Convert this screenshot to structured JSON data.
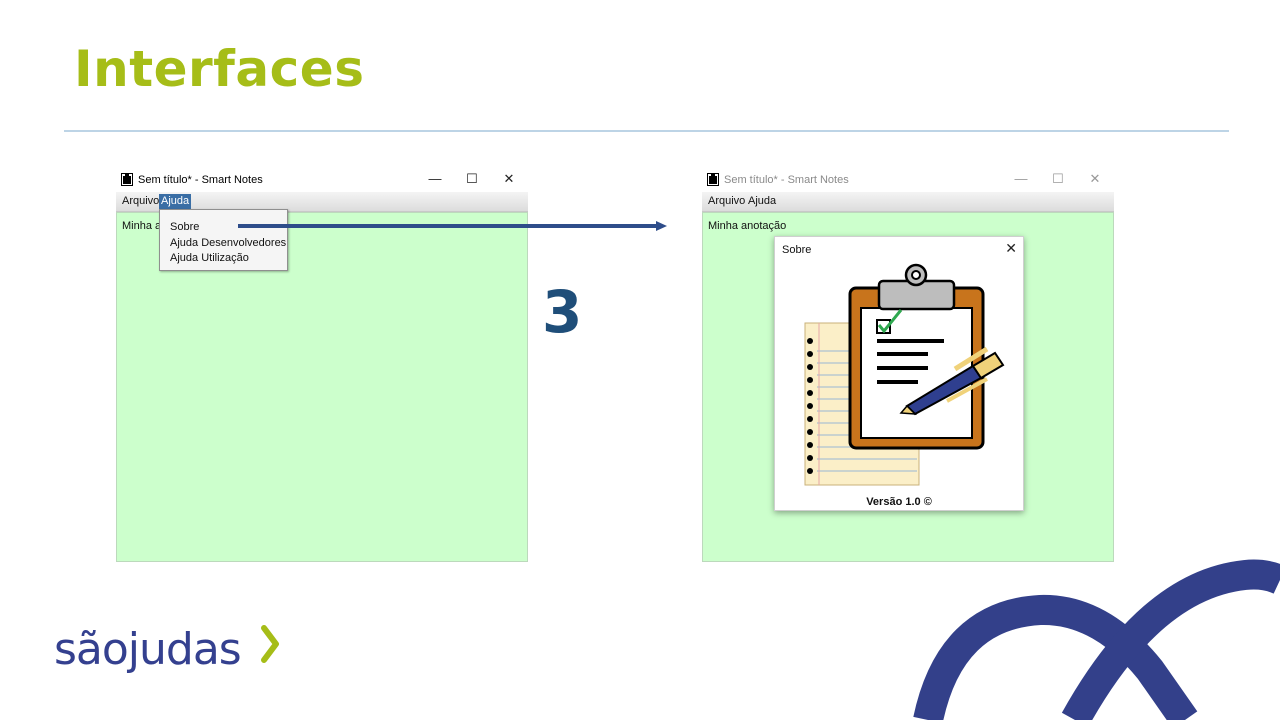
{
  "slide": {
    "title": "Interfaces",
    "step_number": "3"
  },
  "window_left": {
    "title": "Sem título* - Smart Notes",
    "controls": {
      "minimize": "—",
      "maximize": "☐",
      "close": "✕"
    },
    "menu": [
      "Arquivo",
      "Ajuda"
    ],
    "editor_text": "Minha an",
    "dropdown": [
      "Sobre",
      "Ajuda Desenvolvedores",
      "Ajuda Utilização"
    ]
  },
  "window_right": {
    "title": "Sem título* - Smart Notes",
    "controls": {
      "minimize": "—",
      "maximize": "☐",
      "close": "✕"
    },
    "menu": [
      "Arquivo",
      "Ajuda"
    ],
    "editor_text": "Minha anotação"
  },
  "about_dialog": {
    "title": "Sobre",
    "close": "✕",
    "version": "Versão 1.0 ©"
  },
  "logo": {
    "text": "sãojudas"
  },
  "colors": {
    "title": "#a6bd18",
    "accent": "#1f4e79",
    "editor_bg": "#ccffcc",
    "brand": "#34408f"
  }
}
